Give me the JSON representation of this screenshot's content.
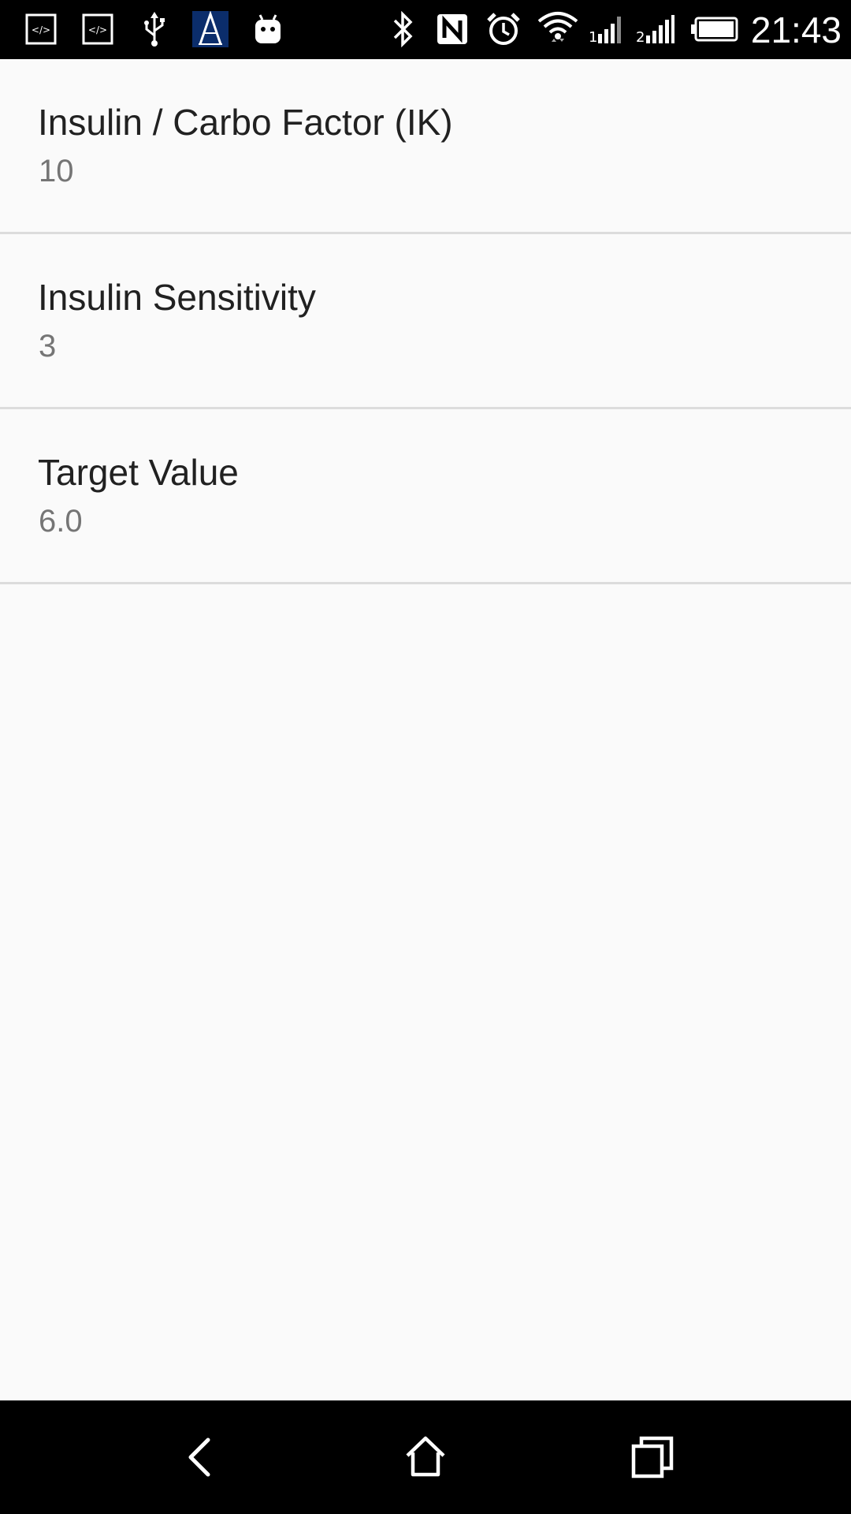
{
  "status_bar": {
    "time": "21:43",
    "left_icons": [
      "dev-code-icon",
      "dev-code-icon",
      "usb-icon",
      "app-a-icon",
      "android-icon"
    ],
    "right_icons": [
      "bluetooth-icon",
      "nfc-icon",
      "alarm-icon",
      "wifi-icon",
      "signal-1-icon",
      "signal-2-icon",
      "battery-icon"
    ]
  },
  "preferences": [
    {
      "title": "Insulin / Carbo Factor (IK)",
      "summary": "10"
    },
    {
      "title": "Insulin Sensitivity",
      "summary": "3"
    },
    {
      "title": "Target Value",
      "summary": "6.0"
    }
  ],
  "nav_bar": {
    "buttons": [
      "back-icon",
      "home-icon",
      "recents-icon"
    ]
  },
  "colors": {
    "background": "#fafafa",
    "title_text": "#212121",
    "summary_text": "#757575",
    "divider": "#dcdcdc",
    "bars": "#000000"
  }
}
